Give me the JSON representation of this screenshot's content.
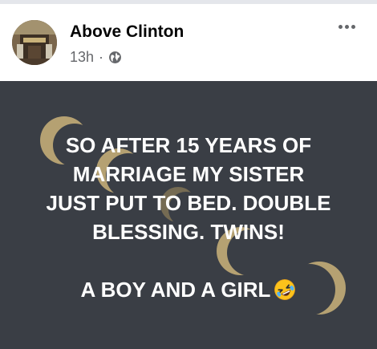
{
  "post": {
    "author": "Above Clinton",
    "time": "13h",
    "separator": "·",
    "privacy_icon": "globe-icon",
    "menu_icon": "more-horizontal-icon",
    "text_lines": [
      "SO AFTER 15 YEARS OF",
      "MARRIAGE MY SISTER",
      "JUST PUT TO BED. DOUBLE",
      "BLESSING. TWINS!"
    ],
    "closing_line": "A BOY AND A GIRL",
    "emoji": "rolling-on-floor-laughing-emoji"
  },
  "colors": {
    "background_panel": "#3a3e45",
    "crescent_gold": "#b5a172",
    "text": "#ffffff",
    "author_text": "#050505",
    "meta_text": "#65676b"
  }
}
